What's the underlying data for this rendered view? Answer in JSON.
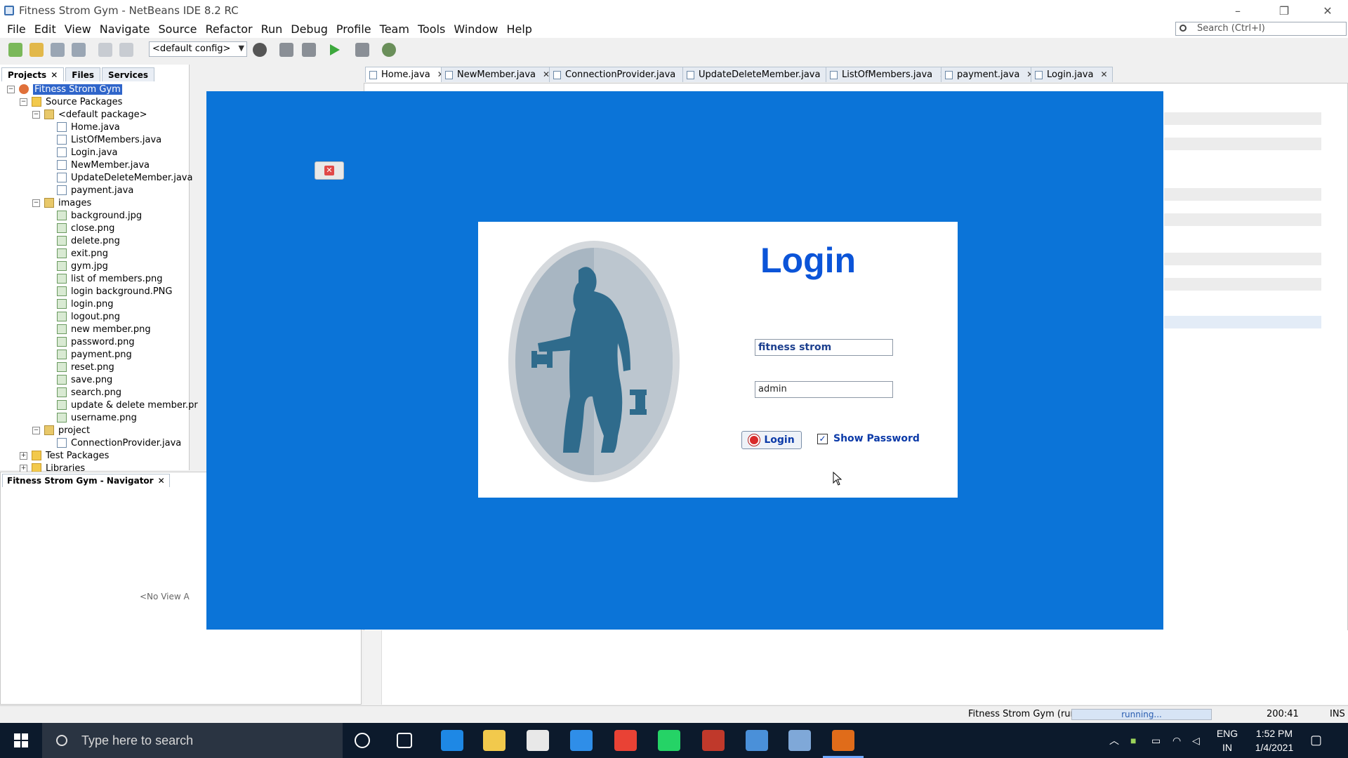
{
  "window": {
    "title": "Fitness Strom Gym - NetBeans IDE 8.2 RC",
    "controls": [
      "–",
      "❐",
      "✕"
    ]
  },
  "menu": [
    "File",
    "Edit",
    "View",
    "Navigate",
    "Source",
    "Refactor",
    "Run",
    "Debug",
    "Profile",
    "Team",
    "Tools",
    "Window",
    "Help"
  ],
  "search": {
    "placeholder": "Search (Ctrl+I)"
  },
  "toolbar": {
    "config": "<default config>"
  },
  "panels": {
    "tabs": [
      "Projects",
      "Files",
      "Services"
    ],
    "navigator_title": "Fitness Strom Gym - Navigator",
    "navigator_empty": "<No View A"
  },
  "tree": [
    {
      "label": "Fitness Strom Gym",
      "depth": 0,
      "kind": "proj",
      "expander": "−",
      "selected": true
    },
    {
      "label": "Source Packages",
      "depth": 1,
      "kind": "folder",
      "expander": "−"
    },
    {
      "label": "<default package>",
      "depth": 2,
      "kind": "pkg",
      "expander": "−"
    },
    {
      "label": "Home.java",
      "depth": 3,
      "kind": "file"
    },
    {
      "label": "ListOfMembers.java",
      "depth": 3,
      "kind": "file"
    },
    {
      "label": "Login.java",
      "depth": 3,
      "kind": "file"
    },
    {
      "label": "NewMember.java",
      "depth": 3,
      "kind": "file"
    },
    {
      "label": "UpdateDeleteMember.java",
      "depth": 3,
      "kind": "file"
    },
    {
      "label": "payment.java",
      "depth": 3,
      "kind": "file"
    },
    {
      "label": "images",
      "depth": 2,
      "kind": "pkg",
      "expander": "−"
    },
    {
      "label": "background.jpg",
      "depth": 3,
      "kind": "img"
    },
    {
      "label": "close.png",
      "depth": 3,
      "kind": "img"
    },
    {
      "label": "delete.png",
      "depth": 3,
      "kind": "img"
    },
    {
      "label": "exit.png",
      "depth": 3,
      "kind": "img"
    },
    {
      "label": "gym.jpg",
      "depth": 3,
      "kind": "img"
    },
    {
      "label": "list of members.png",
      "depth": 3,
      "kind": "img"
    },
    {
      "label": "login background.PNG",
      "depth": 3,
      "kind": "img"
    },
    {
      "label": "login.png",
      "depth": 3,
      "kind": "img"
    },
    {
      "label": "logout.png",
      "depth": 3,
      "kind": "img"
    },
    {
      "label": "new member.png",
      "depth": 3,
      "kind": "img"
    },
    {
      "label": "password.png",
      "depth": 3,
      "kind": "img"
    },
    {
      "label": "payment.png",
      "depth": 3,
      "kind": "img"
    },
    {
      "label": "reset.png",
      "depth": 3,
      "kind": "img"
    },
    {
      "label": "save.png",
      "depth": 3,
      "kind": "img"
    },
    {
      "label": "search.png",
      "depth": 3,
      "kind": "img"
    },
    {
      "label": "update & delete member.pr",
      "depth": 3,
      "kind": "img"
    },
    {
      "label": "username.png",
      "depth": 3,
      "kind": "img"
    },
    {
      "label": "project",
      "depth": 2,
      "kind": "pkg",
      "expander": "−"
    },
    {
      "label": "ConnectionProvider.java",
      "depth": 3,
      "kind": "file"
    },
    {
      "label": "Test Packages",
      "depth": 1,
      "kind": "folder",
      "expander": "+"
    },
    {
      "label": "Libraries",
      "depth": 1,
      "kind": "folder",
      "expander": "+"
    }
  ],
  "editor_tabs": [
    {
      "label": "Home.java",
      "active": true
    },
    {
      "label": "NewMember.java"
    },
    {
      "label": "ConnectionProvider.java"
    },
    {
      "label": "UpdateDeleteMember.java"
    },
    {
      "label": "ListOfMembers.java"
    },
    {
      "label": "payment.java"
    },
    {
      "label": "Login.java"
    }
  ],
  "app": {
    "heading": "Login",
    "username_value": "fitness strom",
    "password_value": "admin",
    "login_button": "Login",
    "show_password_label": "Show Password",
    "show_password_checked": true,
    "colors": {
      "frame_bg": "#0b74d8",
      "title": "#0b54d8"
    }
  },
  "status": {
    "run_label": "Fitness Strom Gym (run)",
    "progress_text": "running...",
    "position": "200:41",
    "mode": "INS"
  },
  "taskbar": {
    "search_placeholder": "Type here to search",
    "apps": [
      "cortana-icon",
      "task-view-icon",
      "edge-icon",
      "file-explorer-icon",
      "store-icon",
      "mail-icon",
      "chrome-icon",
      "whatsapp-icon",
      "paint-icon",
      "qbittorrent-icon",
      "virtualbox-icon",
      "java-icon"
    ],
    "lang_top": "ENG",
    "lang_bottom": "IN",
    "time": "1:52 PM",
    "date": "1/4/2021"
  }
}
